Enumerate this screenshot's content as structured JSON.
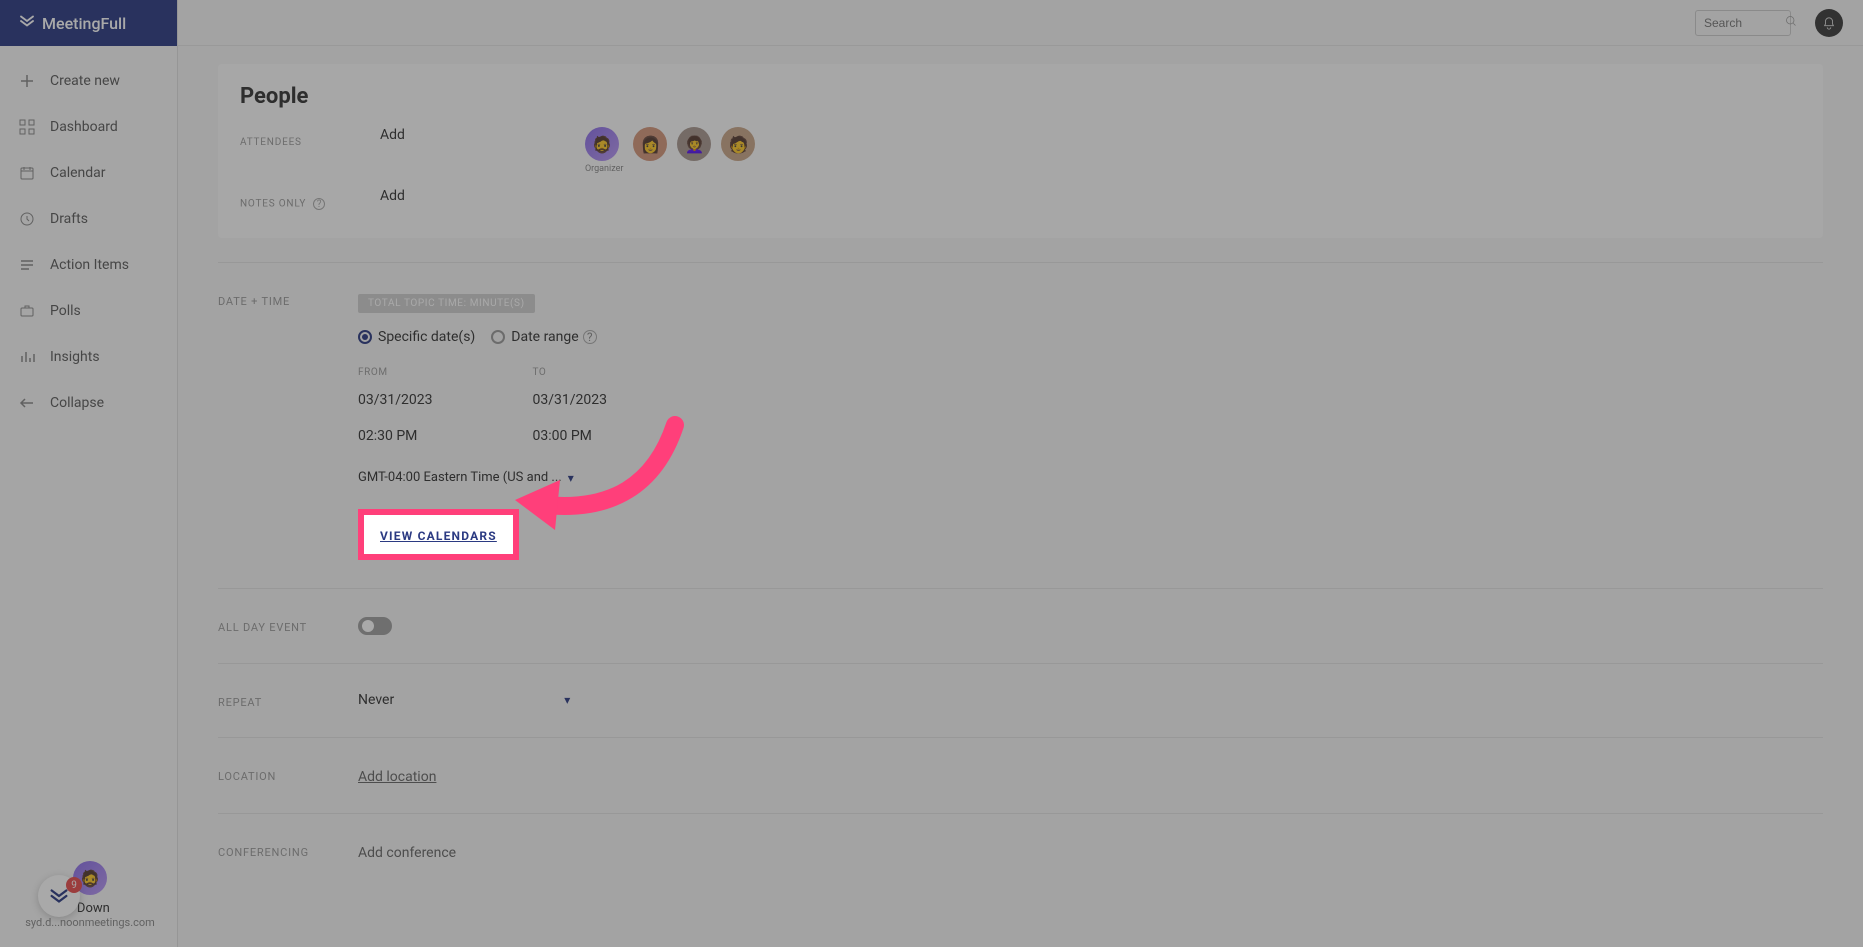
{
  "brand": {
    "name": "MeetingFull"
  },
  "sidebar": {
    "create": "Create new",
    "items": [
      {
        "label": "Dashboard"
      },
      {
        "label": "Calendar"
      },
      {
        "label": "Drafts"
      },
      {
        "label": "Action Items"
      },
      {
        "label": "Polls"
      },
      {
        "label": "Insights"
      }
    ],
    "collapse": "Collapse"
  },
  "user": {
    "name": "I Down",
    "email": "syd.d...noonmeetings.com",
    "chat_badge": "9"
  },
  "topbar": {
    "search_placeholder": "Search"
  },
  "people": {
    "title": "People",
    "attendees_label": "Attendees",
    "notes_only_label": "Notes Only",
    "add": "Add",
    "organizer_label": "Organizer"
  },
  "datetime": {
    "section_label": "Date + Time",
    "topic_badge": "Total Topic Time: Minute(s)",
    "radio_specific": "Specific date(s)",
    "radio_range": "Date range",
    "from_label": "From",
    "to_label": "To",
    "from_date": "03/31/2023",
    "from_time": "02:30 PM",
    "to_date": "03/31/2023",
    "to_time": "03:00 PM",
    "timezone": "GMT-04:00 Eastern Time (US and ...",
    "view_calendars": "View Calendars"
  },
  "all_day": {
    "label": "All Day Event"
  },
  "repeat": {
    "label": "Repeat",
    "value": "Never"
  },
  "location": {
    "label": "Location",
    "add": "Add location"
  },
  "conferencing": {
    "label": "Conferencing",
    "add": "Add conference"
  }
}
